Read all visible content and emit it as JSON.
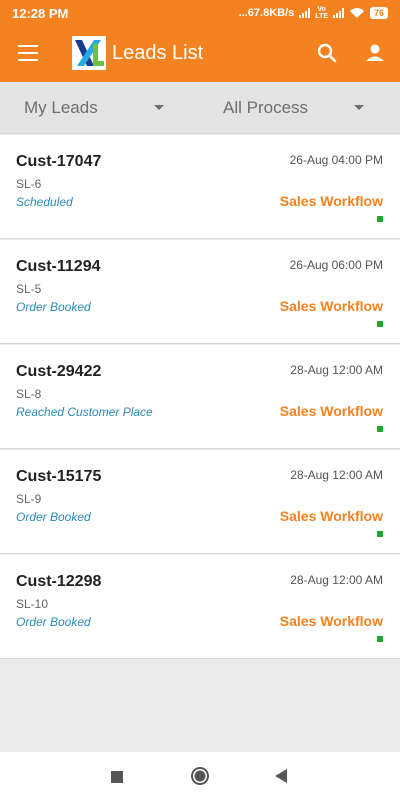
{
  "status_bar": {
    "time": "12:28 PM",
    "indicators": "...67.8KB/s",
    "volte_label": "Vo LTE",
    "battery": "76"
  },
  "app_bar": {
    "title": "Leads List",
    "icons": [
      "menu-icon",
      "app-logo",
      "search-icon",
      "account-icon"
    ]
  },
  "filters": {
    "leads": "My Leads",
    "process": "All Process"
  },
  "leads": [
    {
      "customer": "Cust-17047",
      "sl": "SL-6",
      "status": "Scheduled",
      "date": "26-Aug 04:00 PM",
      "workflow": "Sales Workflow"
    },
    {
      "customer": "Cust-11294",
      "sl": "SL-5",
      "status": "Order Booked",
      "date": "26-Aug 06:00 PM",
      "workflow": "Sales Workflow"
    },
    {
      "customer": "Cust-29422",
      "sl": "SL-8",
      "status": "Reached Customer Place",
      "date": "28-Aug 12:00 AM",
      "workflow": "Sales Workflow"
    },
    {
      "customer": "Cust-15175",
      "sl": "SL-9",
      "status": "Order Booked",
      "date": "28-Aug 12:00 AM",
      "workflow": "Sales Workflow"
    },
    {
      "customer": "Cust-12298",
      "sl": "SL-10",
      "status": "Order Booked",
      "date": "28-Aug 12:00 AM",
      "workflow": "Sales Workflow"
    }
  ],
  "colors": {
    "brand": "#f58220",
    "status_text": "#2a8bb5",
    "indicator": "#1fa82d"
  },
  "nav_icons": [
    "recents-icon",
    "home-icon",
    "back-icon"
  ]
}
